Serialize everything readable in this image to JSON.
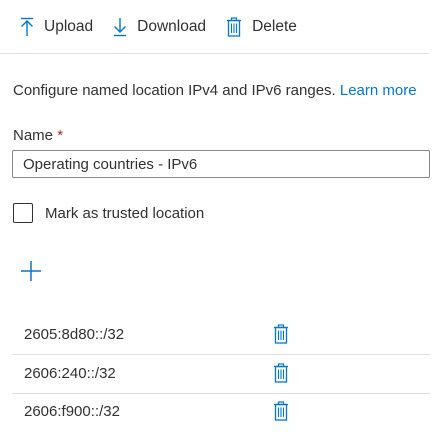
{
  "toolbar": {
    "upload_label": "Upload",
    "download_label": "Download",
    "delete_label": "Delete"
  },
  "description": {
    "text": "Configure named location IPv4 and IPv6 ranges.",
    "link_label": "Learn more"
  },
  "name_field": {
    "label": "Name",
    "required_mark": "*",
    "value": "Operating countries - IPv6"
  },
  "trusted": {
    "label": "Mark as trusted location",
    "checked": false
  },
  "ip_ranges": [
    {
      "value": "2605:8d80::/32"
    },
    {
      "value": "2606:240::/32"
    },
    {
      "value": "2606:f900::/32"
    }
  ],
  "colors": {
    "accent": "#0078d4",
    "text": "#323130",
    "divider": "#e1dfdd",
    "required": "#a4262c"
  }
}
